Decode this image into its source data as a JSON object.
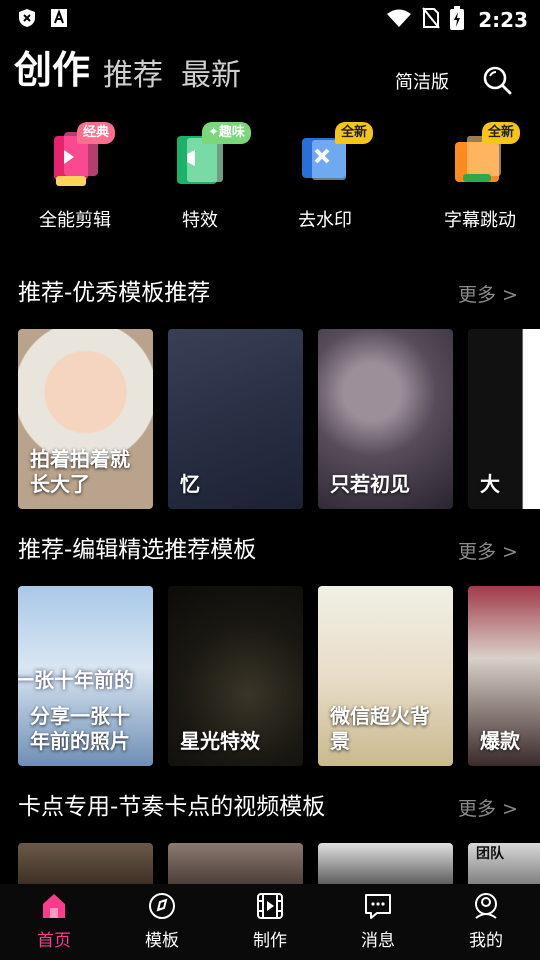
{
  "status": {
    "time": "2:23"
  },
  "header": {
    "tabs": [
      {
        "label": "创作",
        "active": true
      },
      {
        "label": "推荐",
        "active": false
      },
      {
        "label": "最新",
        "active": false
      }
    ],
    "simple_label": "简洁版"
  },
  "tools": [
    {
      "label": "全能剪辑",
      "tag": "经典",
      "tag_color": "#ff6f8d"
    },
    {
      "label": "特效",
      "tag": "✦趣味",
      "tag_color": "#7ad87a"
    },
    {
      "label": "去水印",
      "tag": "全新",
      "tag_color": "#f5c518"
    },
    {
      "label": "字幕跳动",
      "tag": "全新",
      "tag_color": "#f5c518"
    }
  ],
  "sections": [
    {
      "title": "推荐-优秀模板推荐",
      "more": "更多 >",
      "cards": [
        {
          "title": "拍着拍着就长大了"
        },
        {
          "title": "忆"
        },
        {
          "title": "只若初见"
        },
        {
          "title": "大"
        }
      ]
    },
    {
      "title": "推荐-编辑精选推荐模板",
      "more": "更多 >",
      "cards": [
        {
          "title": "分享一张十年前的照片",
          "image_text": "一张十年前的"
        },
        {
          "title": "星光特效"
        },
        {
          "title": "微信超火背景"
        },
        {
          "title": "爆款"
        }
      ]
    },
    {
      "title": "卡点专用-节奏卡点的视频模板",
      "more": "更多 >",
      "cards": [
        {
          "title": ""
        },
        {
          "title": ""
        },
        {
          "title": ""
        },
        {
          "title": "",
          "image_text": "团队"
        }
      ]
    }
  ],
  "bottom_nav": [
    {
      "label": "首页",
      "icon": "home-icon",
      "active": true
    },
    {
      "label": "模板",
      "icon": "template-icon",
      "active": false
    },
    {
      "label": "制作",
      "icon": "film-icon",
      "active": false
    },
    {
      "label": "消息",
      "icon": "message-icon",
      "active": false
    },
    {
      "label": "我的",
      "icon": "profile-icon",
      "active": false
    }
  ],
  "colors": {
    "accent": "#ff3c8c",
    "background": "#000000",
    "muted": "#8a8a8a"
  }
}
